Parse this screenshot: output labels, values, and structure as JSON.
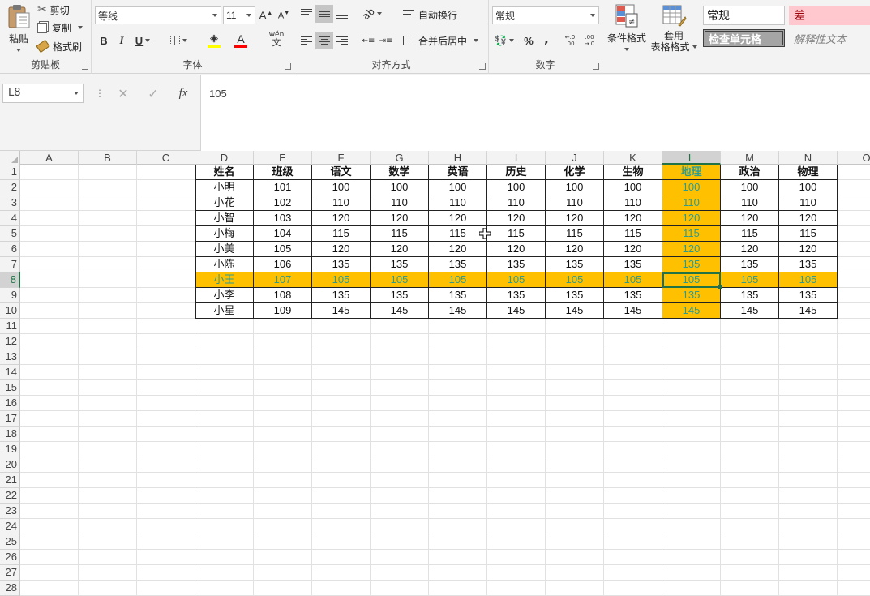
{
  "ribbon": {
    "clipboard": {
      "paste": "粘贴",
      "cut": "剪切",
      "copy": "复制",
      "format_painter": "格式刷",
      "label": "剪贴板"
    },
    "font": {
      "family": "等线",
      "size": "11",
      "bold": "B",
      "italic": "I",
      "underline": "U",
      "font_color_glyph": "A",
      "phonetic": "wén",
      "phonetic_char": "文",
      "label": "字体",
      "fill_color": "#ffff00",
      "text_color": "#ff0000"
    },
    "alignment": {
      "wrap_text": "自动换行",
      "merge_center": "合并后居中",
      "label": "对齐方式"
    },
    "number": {
      "format": "常规",
      "percent": "%",
      "comma": ",",
      "inc_decimal": "←.0 .00",
      "dec_decimal": ".00 →.0",
      "label": "数字"
    },
    "styles": {
      "conditional": "条件格式",
      "table_format_1": "套用",
      "table_format_2": "表格格式",
      "normal": "常规",
      "bad": "差",
      "check_cell": "检查单元格",
      "explanatory": "解释性文本",
      "bad_bg": "#ffc7ce",
      "bad_color": "#9c0006",
      "check_bg": "#a5a5a5"
    }
  },
  "formula_bar": {
    "name_box": "L8",
    "cancel": "✕",
    "enter": "✓",
    "fx": "fx",
    "value": "105"
  },
  "columns": [
    "A",
    "B",
    "C",
    "D",
    "E",
    "F",
    "G",
    "H",
    "I",
    "J",
    "K",
    "L",
    "M",
    "N",
    "O"
  ],
  "rows": [
    "1",
    "2",
    "3",
    "4",
    "5",
    "6",
    "7",
    "8",
    "9",
    "10",
    "11",
    "12",
    "13",
    "14",
    "15",
    "16",
    "17",
    "18",
    "19",
    "20",
    "21",
    "22",
    "23",
    "24",
    "25",
    "26",
    "27",
    "28"
  ],
  "selected": {
    "column": "L",
    "row": "8"
  },
  "highlight_color": "#ffc000",
  "highlight_text_color": "#2e9b8f",
  "table": {
    "header": [
      "姓名",
      "班级",
      "语文",
      "数学",
      "英语",
      "历史",
      "化学",
      "生物",
      "地理",
      "政治",
      "物理"
    ],
    "data": [
      [
        "小明",
        "101",
        "100",
        "100",
        "100",
        "100",
        "100",
        "100",
        "100",
        "100",
        "100"
      ],
      [
        "小花",
        "102",
        "110",
        "110",
        "110",
        "110",
        "110",
        "110",
        "110",
        "110",
        "110"
      ],
      [
        "小智",
        "103",
        "120",
        "120",
        "120",
        "120",
        "120",
        "120",
        "120",
        "120",
        "120"
      ],
      [
        "小梅",
        "104",
        "115",
        "115",
        "115",
        "115",
        "115",
        "115",
        "115",
        "115",
        "115"
      ],
      [
        "小美",
        "105",
        "120",
        "120",
        "120",
        "120",
        "120",
        "120",
        "120",
        "120",
        "120"
      ],
      [
        "小陈",
        "106",
        "135",
        "135",
        "135",
        "135",
        "135",
        "135",
        "135",
        "135",
        "135"
      ],
      [
        "小王",
        "107",
        "105",
        "105",
        "105",
        "105",
        "105",
        "105",
        "105",
        "105",
        "105"
      ],
      [
        "小李",
        "108",
        "135",
        "135",
        "135",
        "135",
        "135",
        "135",
        "135",
        "135",
        "135"
      ],
      [
        "小星",
        "109",
        "145",
        "145",
        "145",
        "145",
        "145",
        "145",
        "145",
        "145",
        "145"
      ]
    ]
  }
}
